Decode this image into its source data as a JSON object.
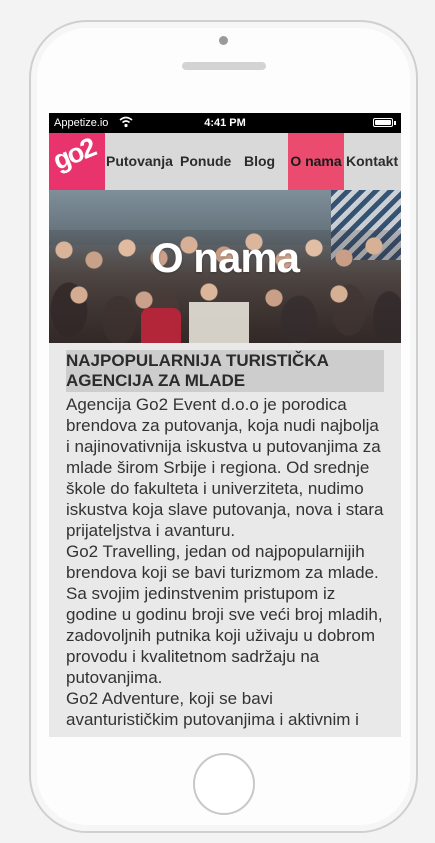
{
  "status_bar": {
    "carrier": "Appetize.io",
    "time": "4:41 PM"
  },
  "nav": {
    "logo_text": "go2",
    "items": [
      "Putovanja",
      "Ponude",
      "Blog",
      "O nama",
      "Kontakt"
    ],
    "active_item": "O nama"
  },
  "hero": {
    "title": "O nama"
  },
  "content": {
    "heading": "NAJPOPULARNIJA TURISTIČKA AGENCIJA ZA MLADE",
    "paragraphs": [
      "Agencija Go2 Event d.o.o je porodica brendova za putovanja, koja nudi najbolja i najinovativnija iskustva u putovanjima za mlade širom Srbije i regiona. Od srednje škole do fakulteta i univerziteta, nudimo iskustva koja slave putovanja, nova i stara prijateljstva i avanturu.",
      "Go2 Travelling, jedan od najpopularnijih brendova koji se bavi turizmom za mlade. Sa svojim jedinstvenim pristupom iz godine u godinu broji sve veći broj mladih, zadovoljnih putnika koji uživaju u dobrom provodu i kvalitetnom sadržaju na putovanjima.",
      "Go2 Adventure,  koji se bavi avanturističkim putovanjima i aktivnim i"
    ]
  },
  "colors": {
    "brand_pink": "#e8336d",
    "active_nav": "#ea4b6e",
    "nav_background": "#d9d9d9",
    "heading_background": "#cdcdcd"
  },
  "icons": [
    "wifi-icon",
    "battery-icon",
    "camera-icon",
    "home-button-icon"
  ]
}
